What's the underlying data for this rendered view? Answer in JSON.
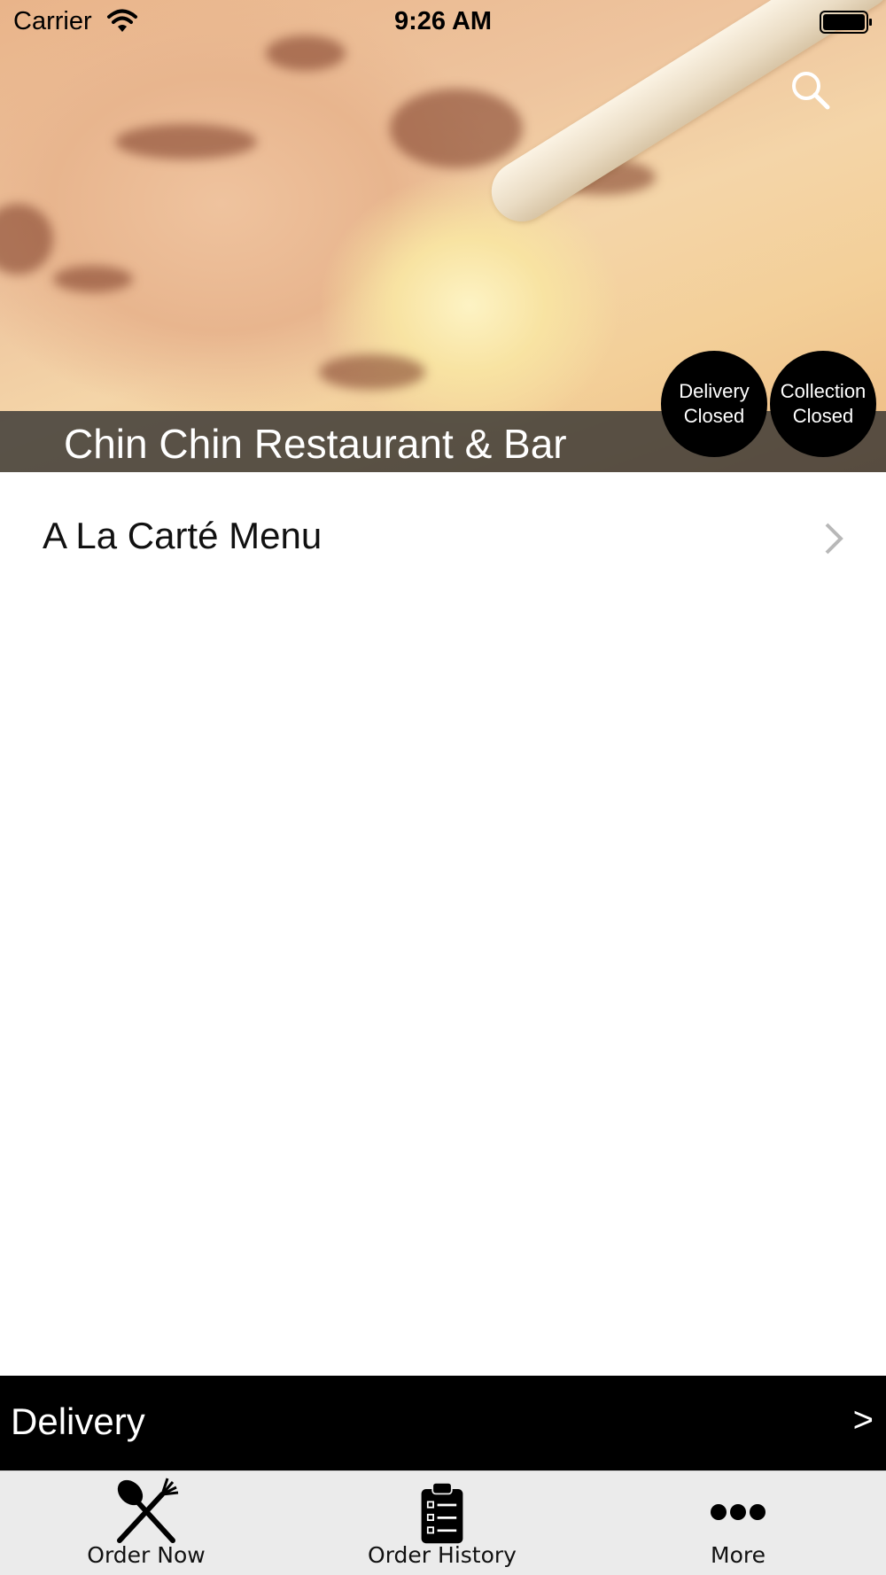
{
  "status_bar": {
    "carrier": "Carrier",
    "time": "9:26 AM"
  },
  "header": {
    "restaurant_name": "Chin Chin Restaurant & Bar",
    "search_icon": "search-icon",
    "delivery_status": {
      "line1": "Delivery",
      "line2": "Closed"
    },
    "collection_status": {
      "line1": "Collection",
      "line2": "Closed"
    }
  },
  "menus": [
    {
      "label": "A La Carté Menu",
      "icon": "chevron-right-icon"
    }
  ],
  "order_type_bar": {
    "label": "Delivery",
    "arrow": ">"
  },
  "tab_bar": {
    "tabs": [
      {
        "label": "Order Now",
        "icon": "cutlery-icon"
      },
      {
        "label": "Order History",
        "icon": "clipboard-icon"
      },
      {
        "label": "More",
        "icon": "ellipsis-icon"
      }
    ]
  },
  "colors": {
    "bar_background": "#000000",
    "tab_bar_background": "#ebebeb",
    "title_band": "#2d2d2d"
  }
}
